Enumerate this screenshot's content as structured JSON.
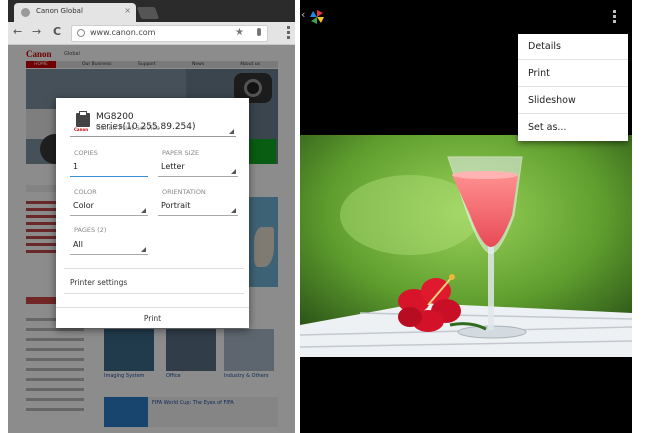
{
  "browser": {
    "tab_title": "Canon Global",
    "tab_close": "×",
    "back": "←",
    "forward": "→",
    "reload": "C",
    "url": "www.canon.com",
    "star": "★"
  },
  "canon_page": {
    "logo": "Canon",
    "region": "Global",
    "nav": [
      "HOME",
      "Our Business",
      "Support",
      "News",
      "About us"
    ],
    "captions": [
      "Imaging System",
      "Office",
      "Industry & Others"
    ],
    "banner": "FIFA World Cup: The Eyes of FIFA"
  },
  "print_dialog": {
    "printer_name": "MG8200 series(10.255.89.254)",
    "printer_service": "Canon Print Service",
    "printer_brand": "Canon",
    "copies_label": "COPIES",
    "copies_value": "1",
    "paper_size_label": "PAPER SIZE",
    "paper_size_value": "Letter",
    "color_label": "COLOR",
    "color_value": "Color",
    "orientation_label": "ORIENTATION",
    "orientation_value": "Portrait",
    "pages_label": "PAGES (2)",
    "pages_value": "All",
    "printer_settings": "Printer settings",
    "print_button": "Print"
  },
  "gallery": {
    "back": "‹",
    "menu_items": [
      "Details",
      "Print",
      "Slideshow",
      "Set as..."
    ]
  }
}
